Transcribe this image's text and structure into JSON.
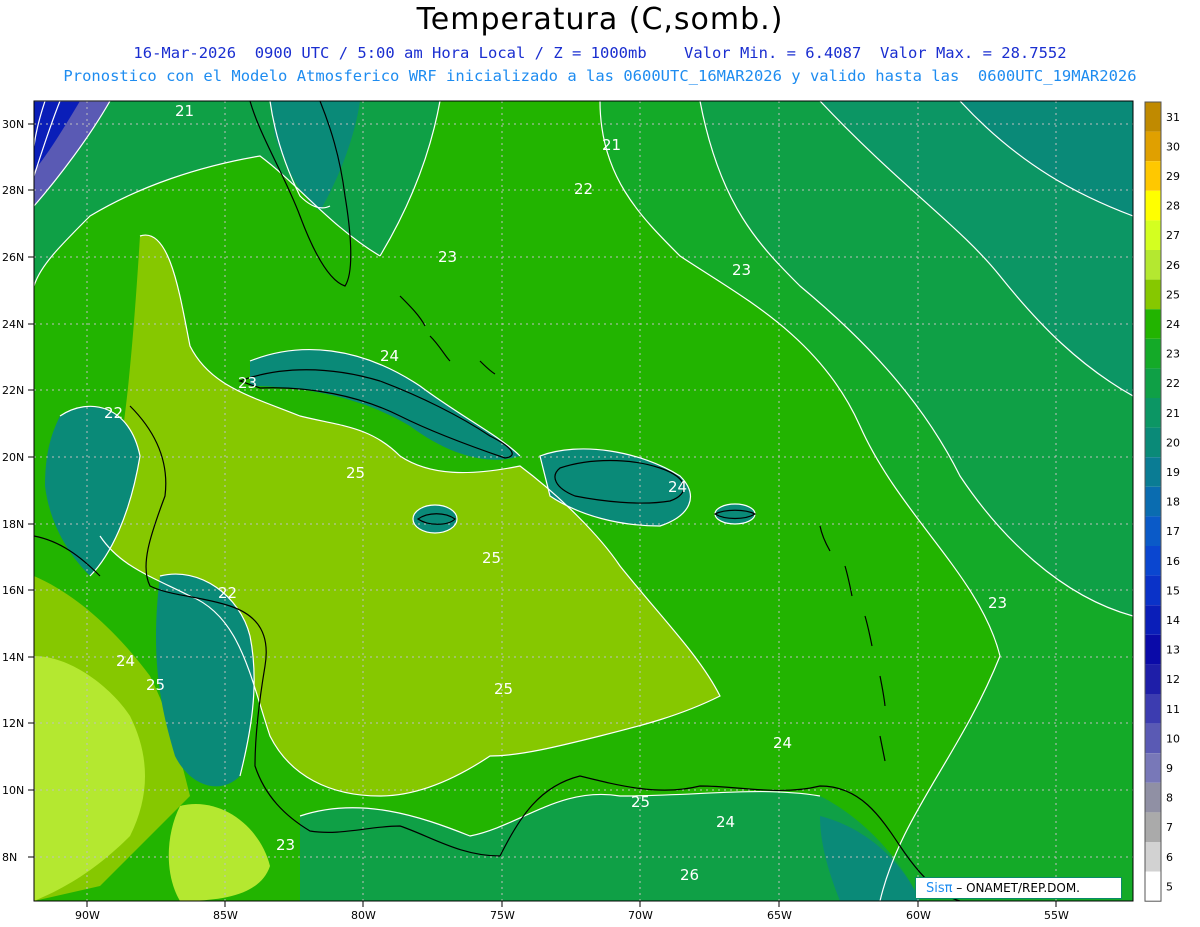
{
  "header": {
    "title": "Temperatura (C,somb.)",
    "line1": "16-Mar-2026  0900 UTC / 5:00 am Hora Local / Z = 1000mb    Valor Min. = 6.4087  Valor Max. = 28.7552",
    "line2": "Pronostico con el Modelo Atmosferico WRF inicializado a las 0600UTC_16MAR2026 y valido hasta las  0600UTC_19MAR2026"
  },
  "axes": {
    "lat_labels": [
      "30N",
      "28N",
      "26N",
      "24N",
      "22N",
      "20N",
      "18N",
      "16N",
      "14N",
      "12N",
      "10N",
      "8N"
    ],
    "lon_labels": [
      "90W",
      "85W",
      "80W",
      "75W",
      "70W",
      "65W",
      "60W",
      "55W"
    ]
  },
  "contour_labels": [
    "21",
    "21",
    "22",
    "23",
    "23",
    "24",
    "23",
    "22",
    "25",
    "24",
    "25",
    "22",
    "24",
    "25",
    "25",
    "23",
    "24",
    "25",
    "24",
    "26",
    "23"
  ],
  "colorbar": {
    "ticks": [
      "31",
      "30",
      "29",
      "28",
      "27",
      "26",
      "25",
      "24",
      "23",
      "22",
      "21",
      "20",
      "19",
      "18",
      "17",
      "16",
      "15",
      "14",
      "13",
      "12",
      "11",
      "10",
      "9",
      "8",
      "7",
      "6",
      "5"
    ],
    "colors": [
      "#c08a00",
      "#e0a000",
      "#ffc800",
      "#ffff00",
      "#d4ff20",
      "#b4e830",
      "#86c800",
      "#22b400",
      "#14aa28",
      "#0fa046",
      "#0c9664",
      "#0a8a78",
      "#0a7c94",
      "#0a6cb0",
      "#0a5ac8",
      "#0a46d0",
      "#0a32c8",
      "#0a1eb8",
      "#0a0aa8",
      "#1e1ea8",
      "#3c3cb0",
      "#5a5ab4",
      "#7878b8",
      "#9090a4",
      "#aaaaaa",
      "#d2d2d2",
      "#ffffff"
    ]
  },
  "credit": {
    "logo": "Sisπ",
    "text": " – ONAMET/REP.DOM."
  }
}
